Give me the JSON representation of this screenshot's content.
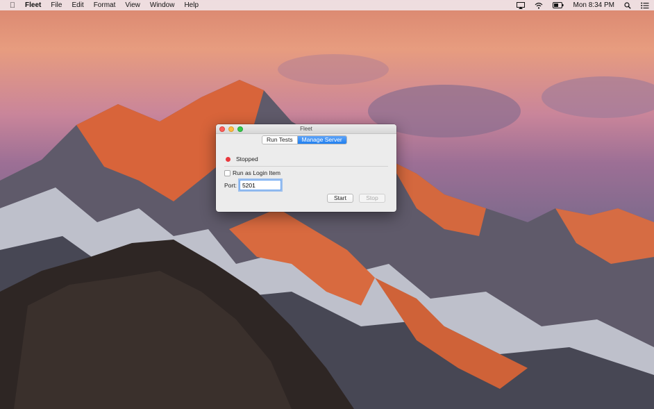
{
  "menubar": {
    "apple_icon": "apple-icon",
    "app_name": "Fleet",
    "items": [
      "File",
      "Edit",
      "Format",
      "View",
      "Window",
      "Help"
    ],
    "status_icons": [
      "airplay-icon",
      "wifi-icon",
      "battery-icon"
    ],
    "clock": "Mon 8:34 PM",
    "right_icons": [
      "search-icon",
      "list-icon"
    ]
  },
  "window": {
    "title": "Fleet",
    "tabs": [
      {
        "label": "Run Tests",
        "active": false
      },
      {
        "label": "Manage Server",
        "active": true
      }
    ],
    "status": {
      "label": "Stopped",
      "color": "#e9383d"
    },
    "login_item": {
      "label": "Run as Login Item",
      "checked": false
    },
    "port": {
      "label": "Port:",
      "value": "5201"
    },
    "buttons": {
      "start": "Start",
      "stop": "Stop"
    }
  }
}
